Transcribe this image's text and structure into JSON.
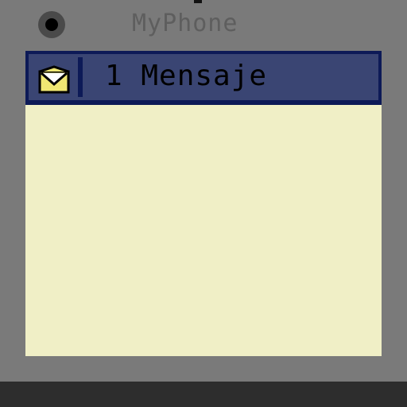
{
  "device": {
    "brand": "MyPhone"
  },
  "notification": {
    "icon": "mail-envelope-icon",
    "text": "1 Mensaje"
  },
  "colors": {
    "body": "#7a7a7a",
    "screen": "#f0efc6",
    "notification_bg": "#3a4573",
    "notification_border": "#0d1a57",
    "envelope": "#f0e873"
  }
}
